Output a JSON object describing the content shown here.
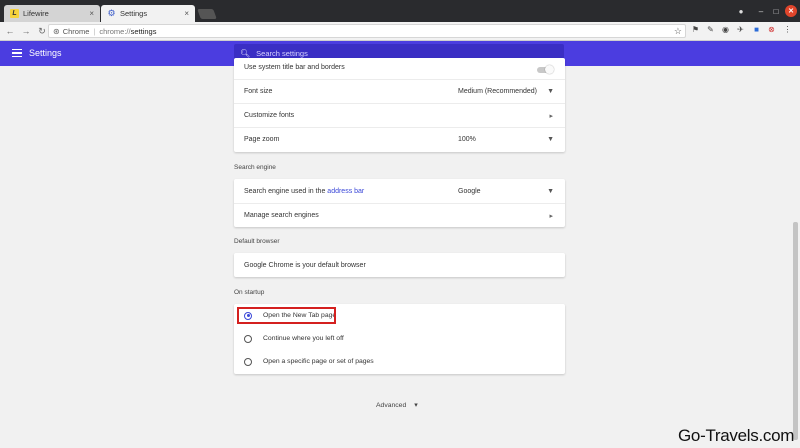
{
  "tabs": [
    {
      "label": "Lifewire",
      "icon": "lifewire-favicon",
      "close": "×"
    },
    {
      "label": "Settings",
      "icon": "settings-gear-icon",
      "close": "×"
    }
  ],
  "address_bar": {
    "scheme_label": "Chrome",
    "url_host": "chrome://",
    "url_path": "settings"
  },
  "header": {
    "title": "Settings",
    "search_placeholder": "Search settings",
    "color": "#4b3de0"
  },
  "appearance": {
    "system_title_bar_label": "Use system title bar and borders",
    "font_size_label": "Font size",
    "font_size_value": "Medium (Recommended)",
    "customize_fonts_label": "Customize fonts",
    "page_zoom_label": "Page zoom",
    "page_zoom_value": "100%"
  },
  "search_engine": {
    "section_title": "Search engine",
    "used_in_label_prefix": "Search engine used in the",
    "used_in_link": "address bar",
    "value": "Google",
    "manage_label": "Manage search engines"
  },
  "default_browser": {
    "section_title": "Default browser",
    "status": "Google Chrome is your default browser"
  },
  "on_startup": {
    "section_title": "On startup",
    "options": [
      {
        "label": "Open the New Tab page",
        "checked": true
      },
      {
        "label": "Continue where you left off",
        "checked": false
      },
      {
        "label": "Open a specific page or set of pages",
        "checked": false
      }
    ]
  },
  "advanced_label": "Advanced",
  "watermark": "Go-Travels.com",
  "colors": {
    "accent": "#4b3de0",
    "highlight_box": "#d4201f",
    "link": "#3b48d8"
  }
}
